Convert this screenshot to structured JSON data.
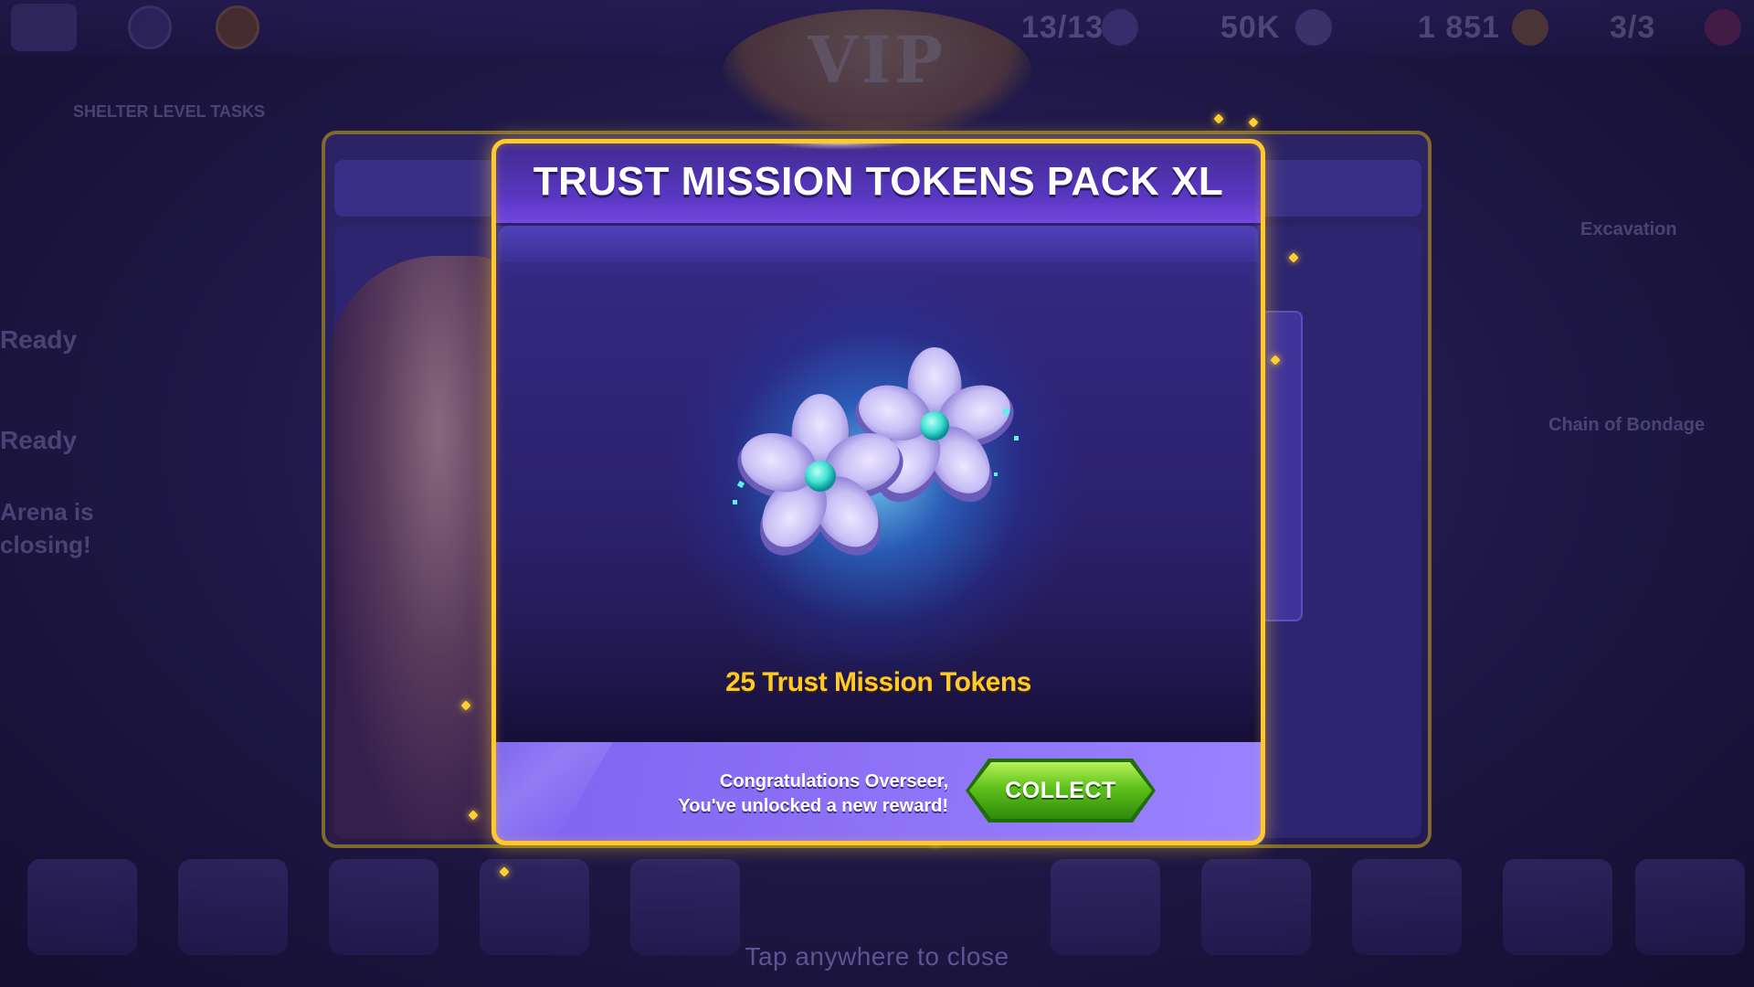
{
  "background": {
    "top_bar": {
      "resources": [
        "13/13",
        "50K",
        "1 851",
        "3/3"
      ]
    },
    "vip_label": "VIP",
    "left_panel": {
      "heading": "SHELTER LEVEL TASKS",
      "items": [
        "Ready",
        "Ready",
        "Arena is closing!"
      ]
    },
    "right_panel": {
      "items": [
        "Excavation",
        "Chain of Bondage"
      ]
    },
    "tap_to_close": "Tap anywhere to close"
  },
  "modal": {
    "title": "TRUST MISSION TOKENS PACK XL",
    "reward_icon": "flower-token-icon",
    "reward_label": "25 Trust Mission Tokens",
    "congrats_line1": "Congratulations Overseer,",
    "congrats_line2": "You've unlocked a new reward!",
    "collect_label": "COLLECT"
  },
  "colors": {
    "accent_gold": "#ffc928",
    "collect_green": "#5fc11c",
    "modal_purple": "#5a37c2",
    "token_teal": "#3de0d0",
    "token_lilac": "#c8bff5"
  }
}
